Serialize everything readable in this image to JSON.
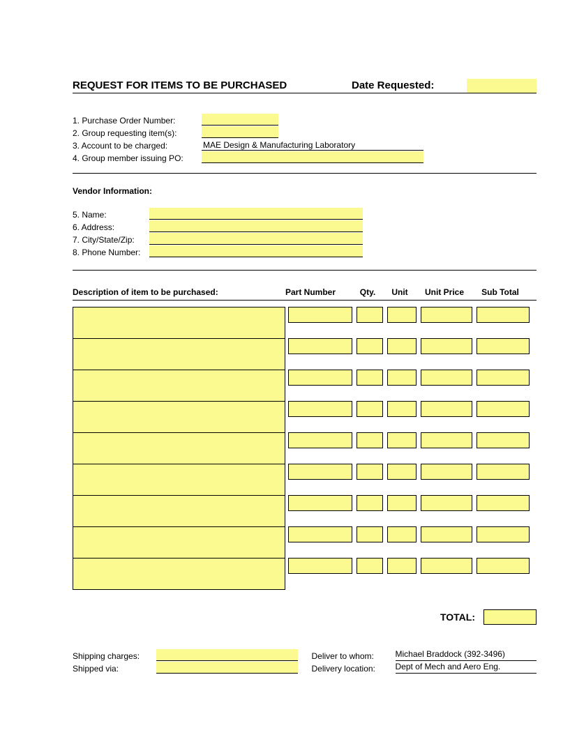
{
  "title": "REQUEST FOR ITEMS TO BE PURCHASED",
  "date_requested_label": "Date Requested:",
  "date_requested": "",
  "fields": {
    "po_number_label": "1. Purchase Order Number:",
    "po_number": "",
    "group_requesting_label": "2. Group requesting item(s):",
    "group_requesting": "",
    "account_label": "3. Account to be charged:",
    "account": "MAE Design & Manufacturing Laboratory",
    "member_issuing_label": "4. Group member issuing PO:",
    "member_issuing": ""
  },
  "vendor_section_label": "Vendor Information:",
  "vendor": {
    "name_label": "5. Name:",
    "name": "",
    "address_label": "6. Address:",
    "address": "",
    "csz_label": "7. City/State/Zip:",
    "csz": "",
    "phone_label": "8. Phone Number:",
    "phone": ""
  },
  "table": {
    "headers": {
      "description": "Description of item to be purchased:",
      "part": "Part Number",
      "qty": "Qty.",
      "unit": "Unit",
      "price": "Unit Price",
      "sub": "Sub Total"
    },
    "rows": [
      {
        "description": "",
        "part": "",
        "qty": "",
        "unit": "",
        "price": "",
        "sub": ""
      },
      {
        "description": "",
        "part": "",
        "qty": "",
        "unit": "",
        "price": "",
        "sub": ""
      },
      {
        "description": "",
        "part": "",
        "qty": "",
        "unit": "",
        "price": "",
        "sub": ""
      },
      {
        "description": "",
        "part": "",
        "qty": "",
        "unit": "",
        "price": "",
        "sub": ""
      },
      {
        "description": "",
        "part": "",
        "qty": "",
        "unit": "",
        "price": "",
        "sub": ""
      },
      {
        "description": "",
        "part": "",
        "qty": "",
        "unit": "",
        "price": "",
        "sub": ""
      },
      {
        "description": "",
        "part": "",
        "qty": "",
        "unit": "",
        "price": "",
        "sub": ""
      },
      {
        "description": "",
        "part": "",
        "qty": "",
        "unit": "",
        "price": "",
        "sub": ""
      },
      {
        "description": "",
        "part": "",
        "qty": "",
        "unit": "",
        "price": "",
        "sub": ""
      }
    ],
    "total_label": "TOTAL:",
    "total": ""
  },
  "footer": {
    "shipping_charges_label": "Shipping charges:",
    "shipping_charges": "",
    "shipped_via_label": "Shipped via:",
    "shipped_via": "",
    "deliver_to_label": "Deliver to whom:",
    "deliver_to": "Michael Braddock (392-3496)",
    "delivery_location_label": "Delivery location:",
    "delivery_location": "Dept of Mech and Aero Eng."
  }
}
